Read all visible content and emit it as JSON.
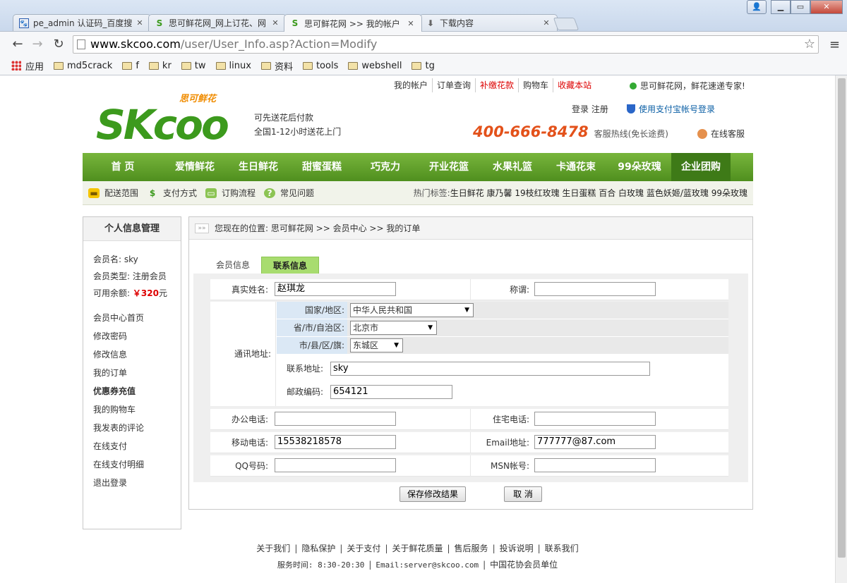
{
  "browser": {
    "tabs": [
      {
        "title": "pe_admin 认证码_百度搜"
      },
      {
        "title": "思可鲜花网_网上订花、网"
      },
      {
        "title": "思可鲜花网 >> 我的帐户"
      },
      {
        "title": "下载内容"
      }
    ],
    "url_host": "www.skcoo.com",
    "url_path": "/user/User_Info.asp?Action=Modify",
    "bookmarks": [
      "应用",
      "md5crack",
      "f",
      "kr",
      "tw",
      "linux",
      "资料",
      "tools",
      "webshell",
      "tg"
    ]
  },
  "header": {
    "topnav": [
      "我的帐户",
      "订单查询",
      "补缴花款",
      "购物车",
      "收藏本站"
    ],
    "slogan": "思可鲜花网，鲜花速递专家!",
    "logo_word": "SKcoo",
    "logo_cn": "思可鲜花",
    "tagline1": "可先送花后付款",
    "tagline2": "全国1-12小时送花上门",
    "login": "登录",
    "register": "注册",
    "alipay": "使用支付宝帐号登录",
    "hotline": "400-666-8478",
    "hotline_note": "客服热线(免长途费)",
    "kefu": "在线客服"
  },
  "mainnav": [
    "首 页",
    "爱情鲜花",
    "生日鲜花",
    "甜蜜蛋糕",
    "巧克力",
    "开业花篮",
    "水果礼篮",
    "卡通花束",
    "99朵玫瑰",
    "企业团购"
  ],
  "subnav": {
    "items": [
      "配送范围",
      "支付方式",
      "订购流程",
      "常见问题"
    ],
    "hot_label": "热门标签:",
    "hot_tags": "生日鲜花 康乃馨 19枝红玫瑰 生日蛋糕 百合 白玫瑰 蓝色妖姬/蓝玫瑰 99朵玫瑰"
  },
  "sidebar": {
    "title": "个人信息管理",
    "member_name_label": "会员名:",
    "member_name": "sky",
    "member_type_label": "会员类型:",
    "member_type": "注册会员",
    "balance_label": "可用余额:",
    "balance_amount": "￥320",
    "balance_unit": "元",
    "links": [
      "会员中心首页",
      "修改密码",
      "修改信息",
      "我的订单",
      "优惠券充值",
      "我的购物车",
      "我发表的评论",
      "在线支付",
      "在线支付明细",
      "退出登录"
    ]
  },
  "breadcrumb": "您现在的位置: 思可鲜花网 >> 会员中心 >> 我的订单",
  "tabs": [
    "会员信息",
    "联系信息"
  ],
  "form": {
    "realname_label": "真实姓名:",
    "realname": "赵琪龙",
    "title_label": "称谓:",
    "title": "",
    "address_label": "通讯地址:",
    "country_label": "国家/地区:",
    "country": "中华人民共和国",
    "province_label": "省/市/自治区:",
    "province": "北京市",
    "district_label": "市/县/区/旗:",
    "district": "东城区",
    "contact_addr_label": "联系地址:",
    "contact_addr": "sky",
    "zip_label": "邮政编码:",
    "zip": "654121",
    "office_phone_label": "办公电话:",
    "office_phone": "",
    "home_phone_label": "住宅电话:",
    "home_phone": "",
    "mobile_label": "移动电话:",
    "mobile": "15538218578",
    "email_label": "Email地址:",
    "email": "777777@87.com",
    "qq_label": "QQ号码:",
    "qq": "",
    "msn_label": "MSN帐号:",
    "msn": "",
    "save": "保存修改结果",
    "cancel": "取 消"
  },
  "footer": {
    "links": [
      "关于我们",
      "隐私保护",
      "关于支付",
      "关于鲜花质量",
      "售后服务",
      "投诉说明",
      "联系我们"
    ],
    "service_time": "服务时间: 8:30-20:30",
    "email": "Email:server@skcoo.com",
    "member": "中国花协会员单位"
  },
  "colors": {
    "brand_green": "#4f8f1e",
    "tab_green": "#a8dc6f",
    "hotline": "#e3511a",
    "price_red": "#dd0000"
  }
}
